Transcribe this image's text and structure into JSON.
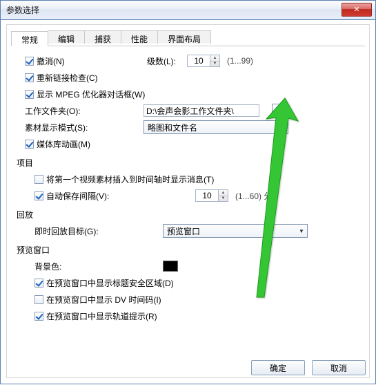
{
  "window": {
    "title": "参数选择",
    "close_glyph": "✕"
  },
  "tabs": [
    "常规",
    "编辑",
    "捕获",
    "性能",
    "界面布局"
  ],
  "general": {
    "undo_label": "撤消(N)",
    "levels_label": "级数(L):",
    "levels_value": "10",
    "levels_hint": "(1...99)",
    "relink_label": "重新链接检查(C)",
    "mpeg_label": "显示 MPEG 优化器对话框(W)",
    "workdir_label": "工作文件夹(O):",
    "workdir_value": "D:\\会声会影工作文件夹\\",
    "browse_glyph": "...",
    "matdisp_label": "素材显示模式(S):",
    "matdisp_value": "略图和文件名",
    "medialib_label": "媒体库动画(M)"
  },
  "project": {
    "heading": "项目",
    "firstclip_label": "将第一个视频素材插入到时间轴时显示消息(T)",
    "autosave_label": "自动保存间隔(V):",
    "autosave_value": "10",
    "autosave_hint": "(1...60) 分"
  },
  "playback": {
    "heading": "回放",
    "target_label": "即时回放目标(G):",
    "target_value": "预览窗口"
  },
  "preview": {
    "heading": "预览窗口",
    "bgcolor_label": "背景色:",
    "bgcolor": "#000000",
    "safezone_label": "在预览窗口中显示标题安全区域(D)",
    "dvtimecode_label": "在预览窗口中显示 DV 时间码(I)",
    "trackhint_label": "在预览窗口中显示轨道提示(R)"
  },
  "buttons": {
    "ok": "确定",
    "cancel": "取消"
  }
}
